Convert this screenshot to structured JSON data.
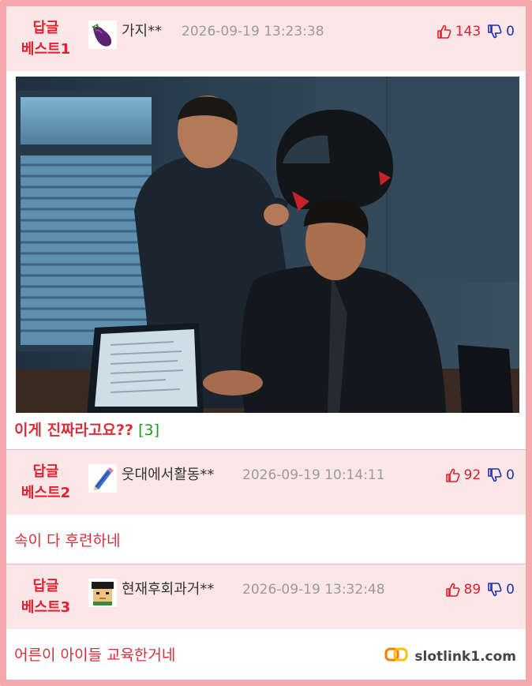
{
  "comments": [
    {
      "rank_line1": "답글",
      "rank_line2": "베스트1",
      "avatar_icon": "eggplant-icon",
      "nickname": "가지**",
      "date": "2026-09-19 13:23:38",
      "upvotes": "143",
      "downvotes": "0",
      "text": "이게 진짜라고요??",
      "reply_count": "[3]",
      "has_image": true
    },
    {
      "rank_line1": "답글",
      "rank_line2": "베스트2",
      "avatar_icon": "pencil-icon",
      "nickname": "웃대에서활동**",
      "date": "2026-09-19 10:14:11",
      "upvotes": "92",
      "downvotes": "0",
      "text": "속이 다 후련하네"
    },
    {
      "rank_line1": "답글",
      "rank_line2": "베스트3",
      "avatar_icon": "pixel-face-icon",
      "nickname": "현재후회과거**",
      "date": "2026-09-19 13:32:48",
      "upvotes": "89",
      "downvotes": "0",
      "text": "어른이 아이들 교육한거네"
    }
  ],
  "watermark": {
    "icon": "chain-link-icon",
    "text": "slotlink1.com"
  },
  "colors": {
    "frame": "#f5a8ad",
    "header_bg": "#fde6e7",
    "accent_red": "#e0202e",
    "downvote_blue": "#1c2fb0",
    "reply_green": "#18a018"
  }
}
